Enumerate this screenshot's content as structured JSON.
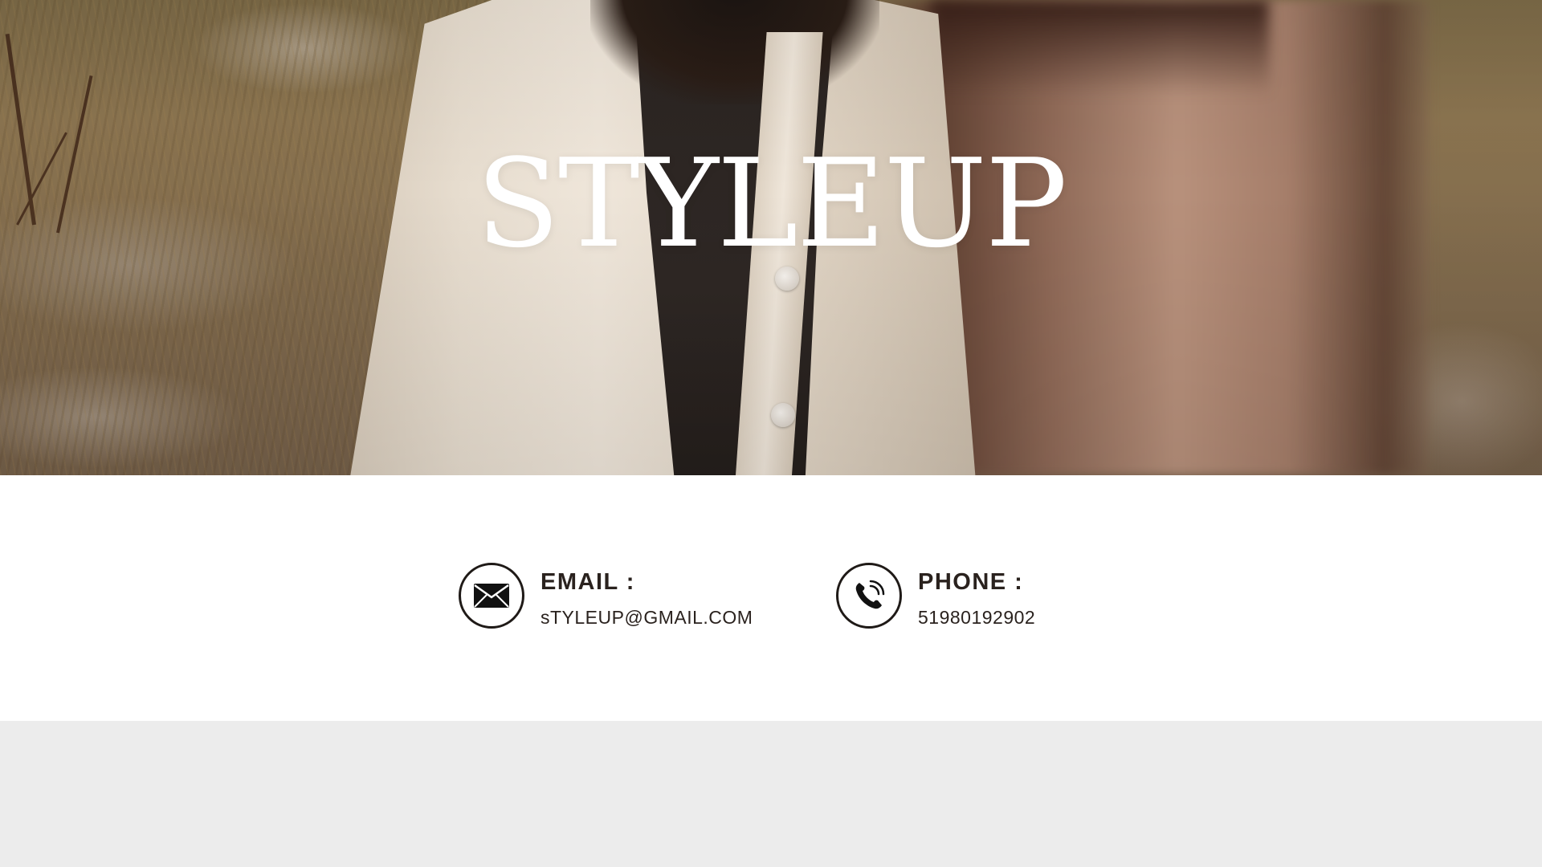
{
  "hero": {
    "brand_title": "STYLEUP"
  },
  "contact": {
    "email": {
      "label": "EMAIL :",
      "value": "sTYLEUP@GMAIL.COM",
      "icon": "envelope-icon"
    },
    "phone": {
      "label": "PHONE :",
      "value": "51980192902",
      "icon": "phone-icon"
    }
  },
  "colors": {
    "text_dark": "#2a221e",
    "contact_background": "#ffffff",
    "footer_background": "#ececec",
    "brand_text": "#ffffff"
  }
}
